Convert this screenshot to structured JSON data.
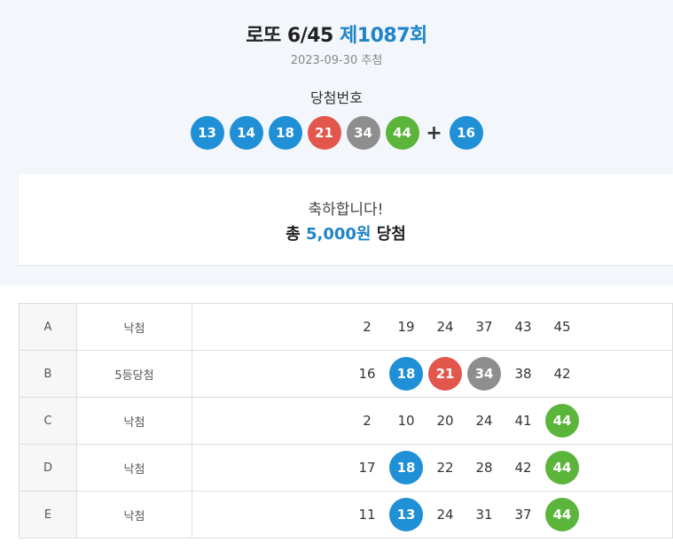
{
  "header": {
    "title_prefix": "로또 6/45",
    "round": "제1087회",
    "draw_date": "2023-09-30 추첨",
    "winning_label": "당첨번호",
    "plus": "+"
  },
  "winning_numbers": [
    {
      "value": "13",
      "color": "#1f8fd6"
    },
    {
      "value": "14",
      "color": "#1f8fd6"
    },
    {
      "value": "18",
      "color": "#1f8fd6"
    },
    {
      "value": "21",
      "color": "#e2564b"
    },
    {
      "value": "34",
      "color": "#8e8e8e"
    },
    {
      "value": "44",
      "color": "#5ab53a"
    }
  ],
  "bonus_number": {
    "value": "16",
    "color": "#1f8fd6"
  },
  "result": {
    "congrats": "축하합니다!",
    "prize_prefix": "총",
    "prize_amount": "5,000원",
    "prize_suffix": "당첨"
  },
  "ball_colors": {
    "blue": "#1f8fd6",
    "red": "#e2564b",
    "gray": "#8e8e8e",
    "green": "#5ab53a"
  },
  "games": [
    {
      "label": "A",
      "result": "낙첨",
      "numbers": [
        {
          "value": "2"
        },
        {
          "value": "19"
        },
        {
          "value": "24"
        },
        {
          "value": "37"
        },
        {
          "value": "43"
        },
        {
          "value": "45"
        }
      ]
    },
    {
      "label": "B",
      "result": "5등당첨",
      "numbers": [
        {
          "value": "16"
        },
        {
          "value": "18",
          "hit": "blue"
        },
        {
          "value": "21",
          "hit": "red"
        },
        {
          "value": "34",
          "hit": "gray"
        },
        {
          "value": "38"
        },
        {
          "value": "42"
        }
      ]
    },
    {
      "label": "C",
      "result": "낙첨",
      "numbers": [
        {
          "value": "2"
        },
        {
          "value": "10"
        },
        {
          "value": "20"
        },
        {
          "value": "24"
        },
        {
          "value": "41"
        },
        {
          "value": "44",
          "hit": "green"
        }
      ]
    },
    {
      "label": "D",
      "result": "낙첨",
      "numbers": [
        {
          "value": "17"
        },
        {
          "value": "18",
          "hit": "blue"
        },
        {
          "value": "22"
        },
        {
          "value": "28"
        },
        {
          "value": "42"
        },
        {
          "value": "44",
          "hit": "green"
        }
      ]
    },
    {
      "label": "E",
      "result": "낙첨",
      "numbers": [
        {
          "value": "11"
        },
        {
          "value": "13",
          "hit": "blue"
        },
        {
          "value": "24"
        },
        {
          "value": "31"
        },
        {
          "value": "37"
        },
        {
          "value": "44",
          "hit": "green"
        }
      ]
    }
  ]
}
